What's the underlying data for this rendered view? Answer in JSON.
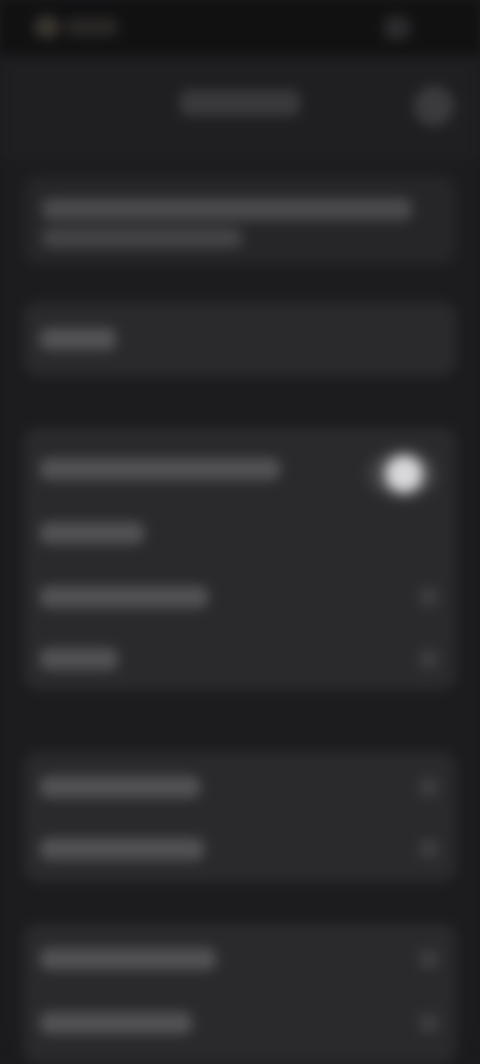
{
  "status_bar": {
    "app_dot_color": "#3a3530"
  },
  "header": {
    "title": "",
    "action_icon": "circle-button-icon"
  },
  "banner": {
    "line1": "",
    "line2": ""
  },
  "single_card": {
    "label": ""
  },
  "group1": {
    "rows": [
      {
        "label": "",
        "control": "toggle",
        "toggle_on": true
      },
      {
        "label": "",
        "control": "none"
      },
      {
        "label": "",
        "control": "chevron"
      },
      {
        "label": "",
        "control": "chevron"
      }
    ]
  },
  "group2": {
    "rows": [
      {
        "label": "",
        "control": "chevron"
      },
      {
        "label": "",
        "control": "chevron"
      }
    ]
  },
  "group3": {
    "rows": [
      {
        "label": "",
        "control": "chevron"
      },
      {
        "label": "",
        "control": "chevron"
      }
    ]
  },
  "colors": {
    "background": "#1c1c1e",
    "card": "#2a2a2c",
    "toggle_knob": "#d8d8da"
  }
}
